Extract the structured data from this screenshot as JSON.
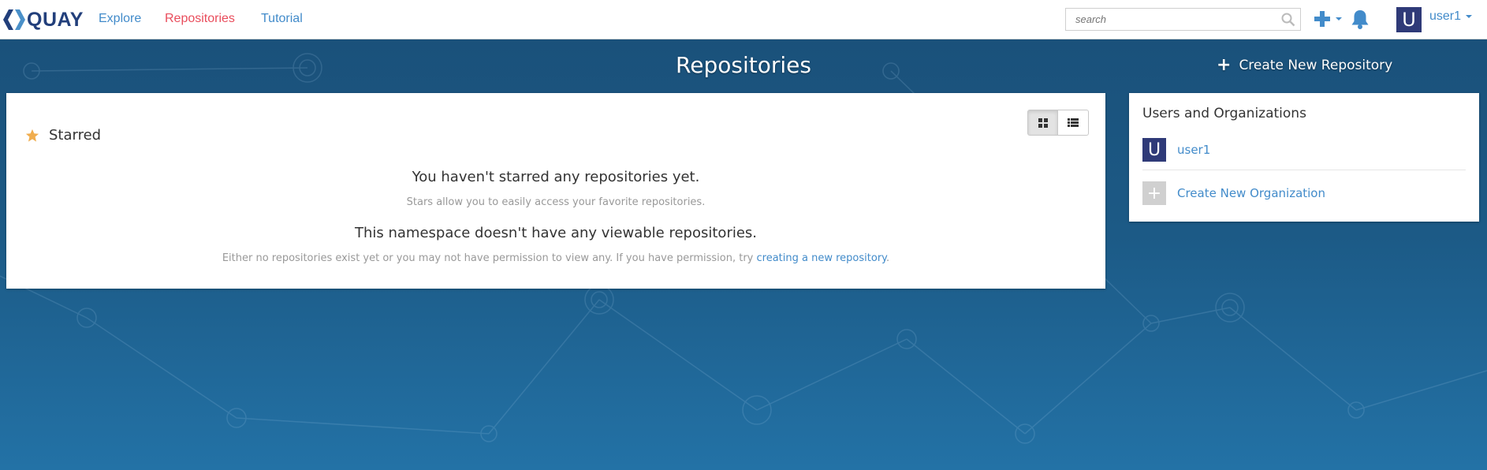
{
  "navbar": {
    "brand": "QUAY",
    "links": [
      {
        "label": "Explore",
        "active": false
      },
      {
        "label": "Repositories",
        "active": true
      },
      {
        "label": "Tutorial",
        "active": false
      }
    ],
    "search_placeholder": "search",
    "user": {
      "avatar_letter": "U",
      "name": "user1"
    }
  },
  "header": {
    "title": "Repositories",
    "create_repo_label": "Create New Repository"
  },
  "main": {
    "starred_label": "Starred",
    "empty_starred_title": "You haven't starred any repositories yet.",
    "empty_starred_sub": "Stars allow you to easily access your favorite repositories.",
    "empty_ns_title": "This namespace doesn't have any viewable repositories.",
    "empty_ns_sub": "Either no repositories exist yet or you may not have permission to view any. If you have permission, try ",
    "empty_ns_link": "creating a new repository",
    "empty_ns_end": "."
  },
  "side": {
    "title": "Users and Organizations",
    "user": {
      "avatar_letter": "U",
      "name": "user1"
    },
    "create_org_label": "Create New Organization",
    "create_org_icon": "+"
  },
  "colors": {
    "brand": "#223f7b",
    "link": "#428bca",
    "active_link": "#e94d5c",
    "star": "#f0ad4e",
    "background_top": "#1a4f78",
    "background_bottom": "#2372a6"
  }
}
